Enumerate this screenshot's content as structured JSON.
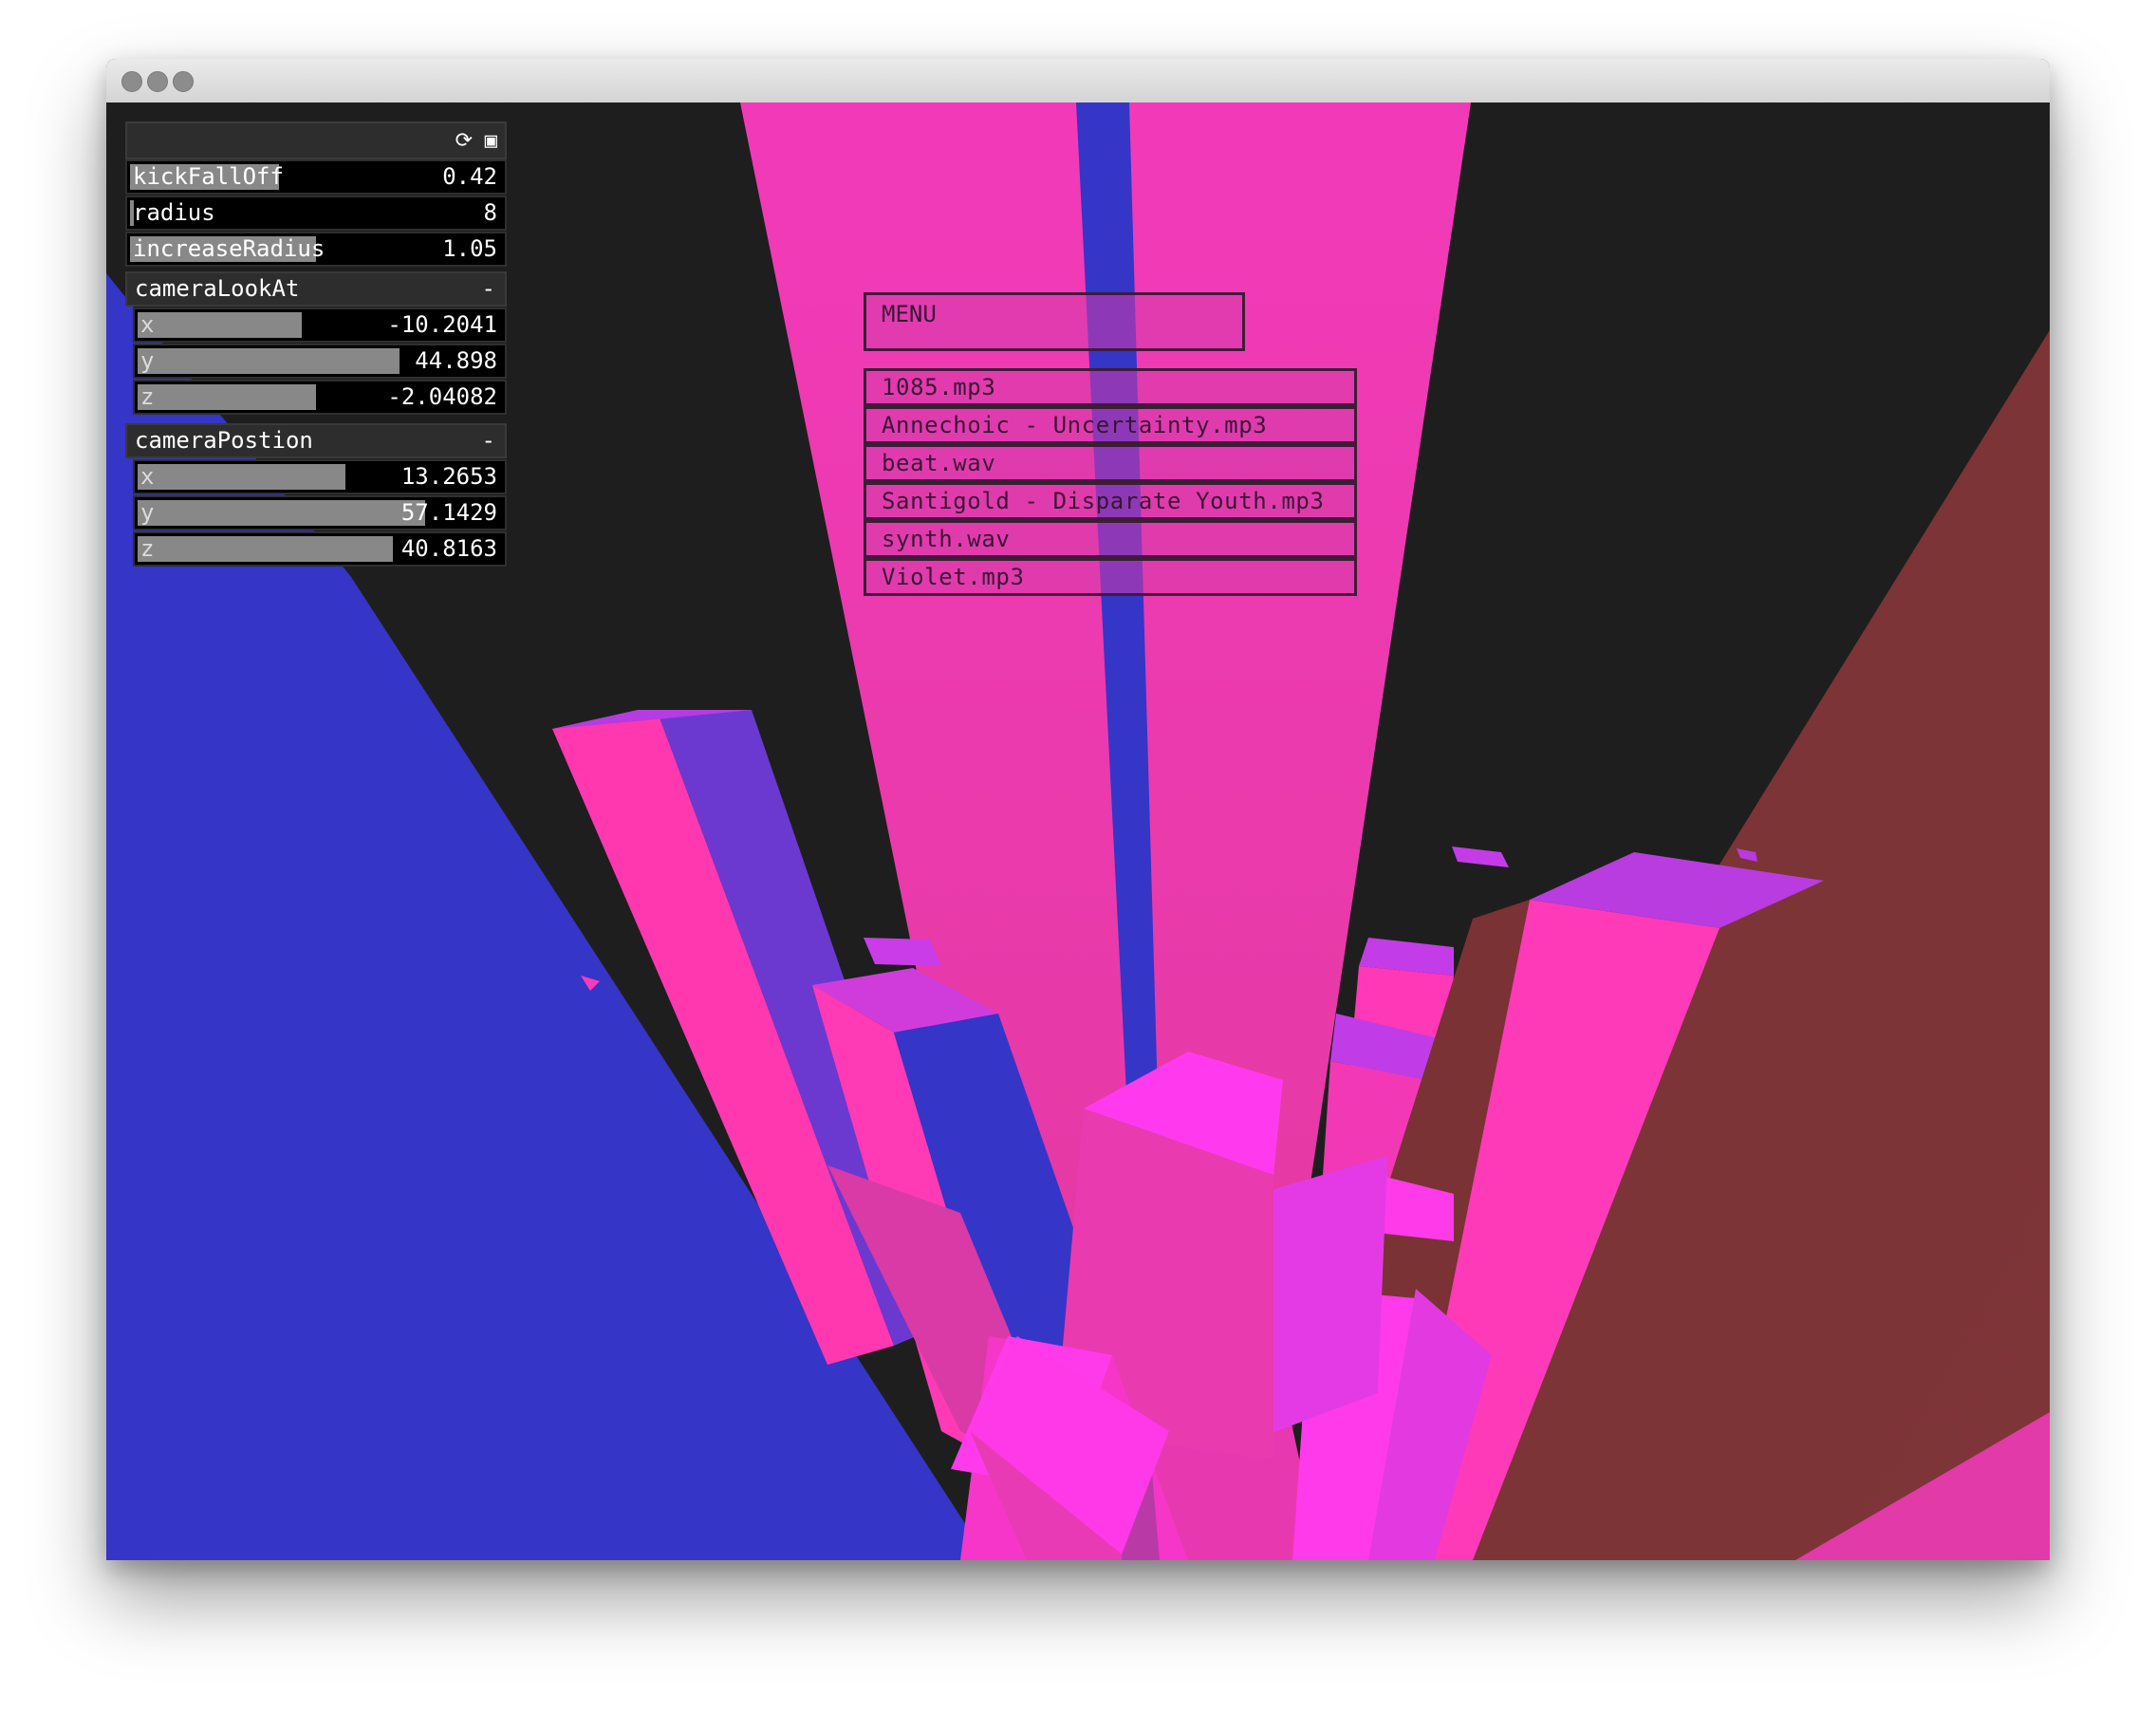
{
  "window": {
    "traffic_lights": [
      "close",
      "minimize",
      "maximize"
    ]
  },
  "gui": {
    "header_icons": [
      "refresh-icon",
      "save-icon"
    ],
    "params": [
      {
        "label": "kickFallOff",
        "value": "0.42",
        "level": 0.4
      },
      {
        "label": "radius",
        "value": "8",
        "level": 0.01
      },
      {
        "label": "increaseRadius",
        "value": "1.05",
        "level": 0.5
      }
    ],
    "groups": [
      {
        "label": "cameraLookAt",
        "toggle": "-",
        "fields": [
          {
            "label": "x",
            "value": "-10.2041",
            "level": 0.45
          },
          {
            "label": "y",
            "value": "44.898",
            "level": 0.72
          },
          {
            "label": "z",
            "value": "-2.04082",
            "level": 0.49
          }
        ]
      },
      {
        "label": "cameraPostion",
        "toggle": "-",
        "fields": [
          {
            "label": "x",
            "value": "13.2653",
            "level": 0.57
          },
          {
            "label": "y",
            "value": "57.1429",
            "level": 0.79
          },
          {
            "label": "z",
            "value": "40.8163",
            "level": 0.7
          }
        ]
      }
    ]
  },
  "menu": {
    "title": "MENU",
    "items": [
      "1085.mp3",
      "Annechoic - Uncertainty.mp3",
      "beat.wav",
      "Santigold - Disparate Youth.mp3",
      "synth.wav",
      "Violet.mp3"
    ]
  },
  "colors": {
    "background": "#1e1e1e",
    "pink": "#f236b8",
    "magenta": "#ff35e8",
    "blue": "#3535c8",
    "brown": "#7a3234",
    "purple": "#b93ce0"
  }
}
